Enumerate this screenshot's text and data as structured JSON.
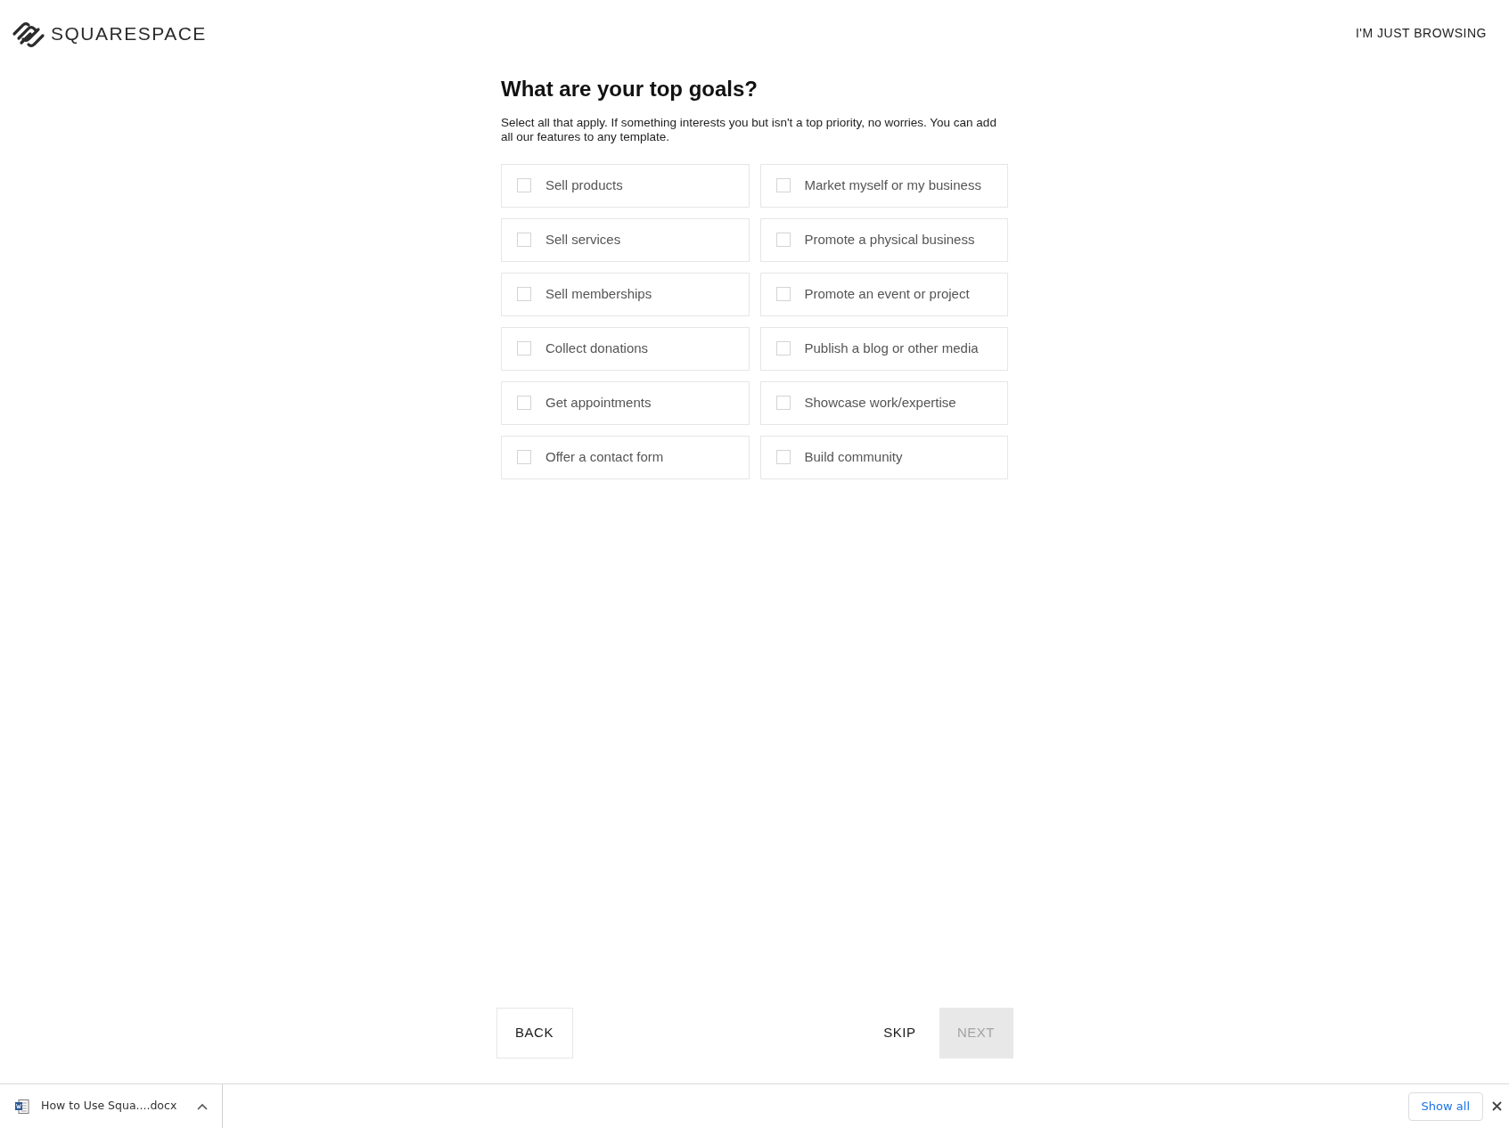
{
  "header": {
    "logo": "SQUARESPACE",
    "browse_link": "I'M JUST BROWSING"
  },
  "title": "What are your top goals?",
  "subtitle": "Select all that apply. If something interests you but isn't a top priority, no worries. You can add all our features to any template.",
  "options": [
    {
      "label": "Sell products",
      "checked": false
    },
    {
      "label": "Market myself or my business",
      "checked": false
    },
    {
      "label": "Sell services",
      "checked": false
    },
    {
      "label": "Promote a physical business",
      "checked": false
    },
    {
      "label": "Sell memberships",
      "checked": false
    },
    {
      "label": "Promote an event or project",
      "checked": false
    },
    {
      "label": "Collect donations",
      "checked": false
    },
    {
      "label": "Publish a blog or other media",
      "checked": false
    },
    {
      "label": "Get appointments",
      "checked": false
    },
    {
      "label": "Showcase work/expertise",
      "checked": false
    },
    {
      "label": "Offer a contact form",
      "checked": false
    },
    {
      "label": "Build community",
      "checked": false
    }
  ],
  "footer": {
    "back": "BACK",
    "skip": "SKIP",
    "next": {
      "label": "NEXT",
      "disabled": true
    }
  },
  "download_bar": {
    "file": "How to Use Squa....docx",
    "show_all": "Show all"
  }
}
